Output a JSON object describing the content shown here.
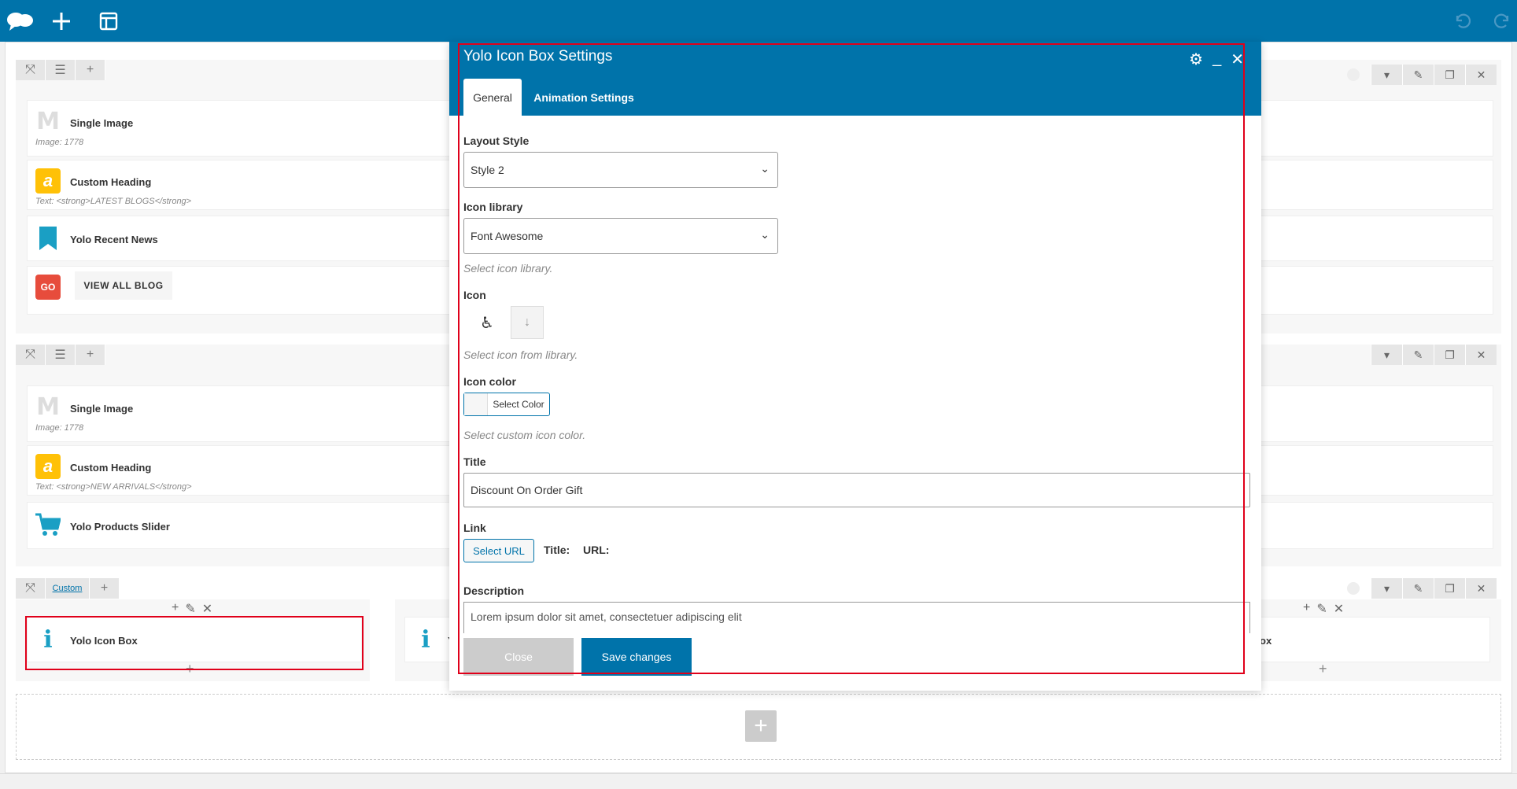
{
  "toolbar": {
    "logo_icon": "cloud-logo-icon",
    "add_icon": "plus-icon",
    "templates_icon": "layout-icon",
    "undo_icon": "undo-icon",
    "redo_icon": "redo-icon"
  },
  "rows": [
    {
      "elements": [
        {
          "title": "Single Image",
          "sub": "Image: 1778"
        },
        {
          "title": "Custom Heading",
          "sub": "Text: <strong>LATEST BLOGS</strong>"
        },
        {
          "title": "Yolo Recent News"
        },
        {
          "button": "VIEW ALL BLOG",
          "badge": "GO"
        }
      ]
    },
    {
      "elements": [
        {
          "title": "Single Image",
          "sub": "Image: 1778"
        },
        {
          "title": "Custom Heading",
          "sub": "Text: <strong>NEW ARRIVALS</strong>"
        },
        {
          "title": "Yolo Products Slider"
        }
      ]
    },
    {
      "custom_label": "Custom",
      "elements": [
        {
          "title": "Yolo Icon Box"
        },
        {
          "title_partial_mid": "Y"
        },
        {
          "title_partial_right": "ox"
        }
      ]
    }
  ],
  "modal": {
    "title": "Yolo Icon Box Settings",
    "tabs": [
      {
        "label": "General"
      },
      {
        "label": "Animation Settings"
      }
    ],
    "fields": {
      "layout_style": {
        "label": "Layout Style",
        "value": "Style 2"
      },
      "icon_library": {
        "label": "Icon library",
        "value": "Font Awesome",
        "help": "Select icon library."
      },
      "icon": {
        "label": "Icon",
        "help": "Select icon from library."
      },
      "icon_color": {
        "label": "Icon color",
        "button": "Select Color",
        "help": "Select custom icon color."
      },
      "title": {
        "label": "Title",
        "value": "Discount On Order Gift"
      },
      "link": {
        "label": "Link",
        "button": "Select URL",
        "title_label": "Title:",
        "url_label": "URL:"
      },
      "description": {
        "label": "Description",
        "value": "Lorem ipsum dolor sit amet, consectetuer adipiscing elit"
      }
    },
    "footer": {
      "close": "Close",
      "save": "Save changes"
    }
  },
  "colors": {
    "accent": "#0073aa",
    "highlight": "#e0001a"
  }
}
